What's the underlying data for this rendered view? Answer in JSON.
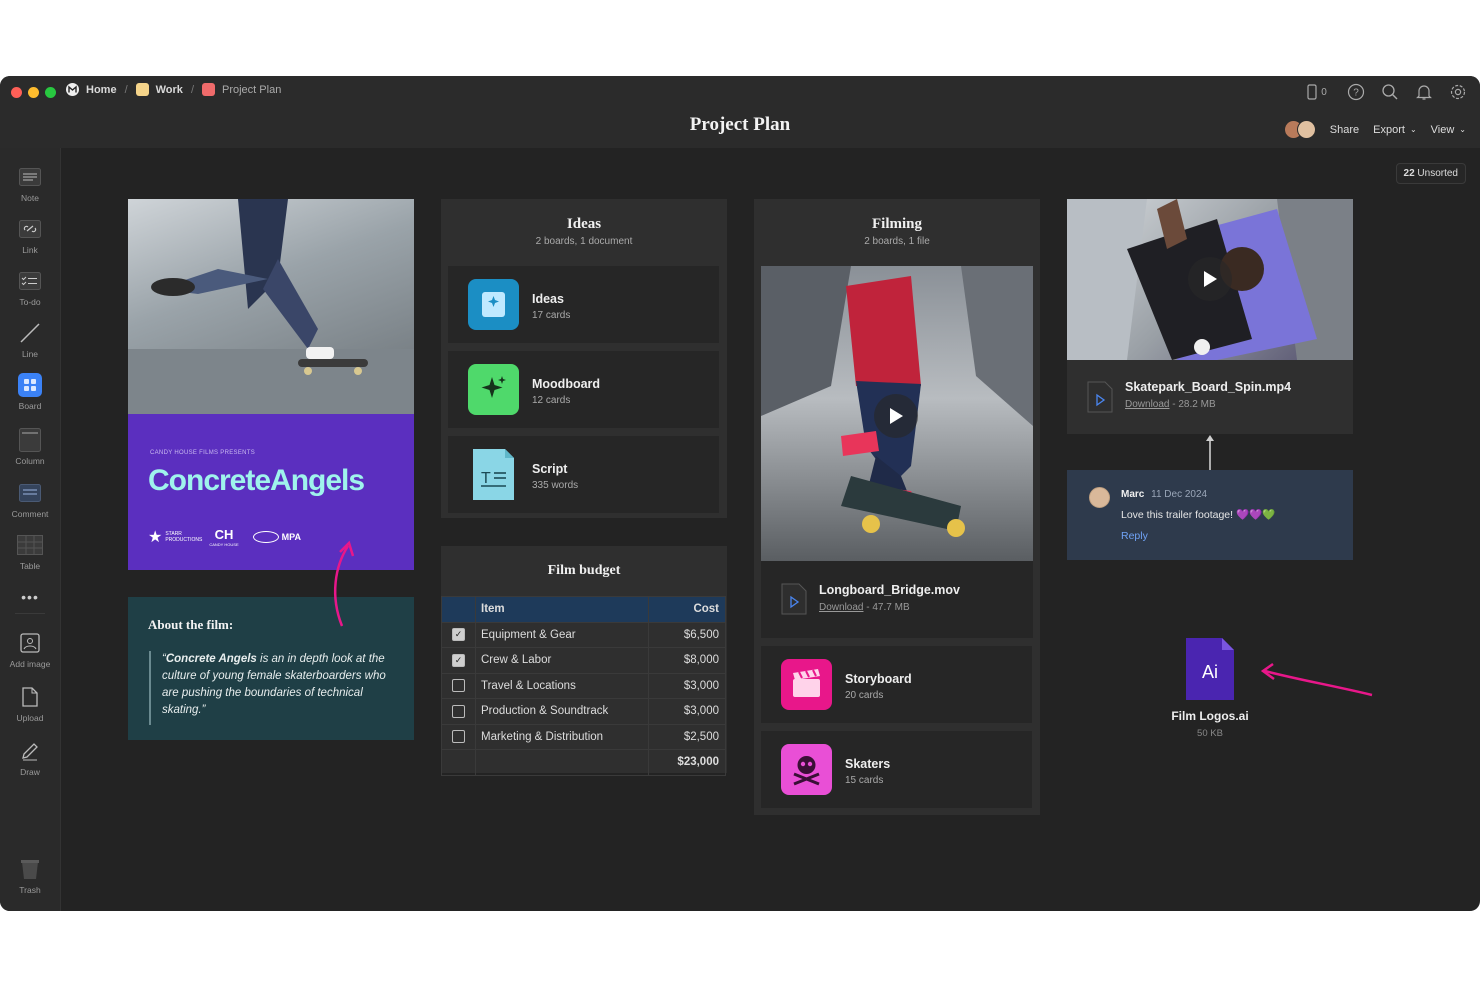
{
  "breadcrumb": {
    "home": "Home",
    "work": "Work",
    "current": "Project Plan"
  },
  "header": {
    "title": "Project Plan",
    "device_count": "0",
    "share": "Share",
    "export": "Export",
    "view": "View"
  },
  "unsorted": {
    "count": "22",
    "label": "Unsorted"
  },
  "sidebar": {
    "tools": [
      "Note",
      "Link",
      "To-do",
      "Line",
      "Board",
      "Column",
      "Comment",
      "Table",
      "Add image",
      "Upload",
      "Draw"
    ],
    "trash": "Trash"
  },
  "poster": {
    "presents": "CANDY HOUSE FILMS PRESENTS",
    "title": "ConcreteAngels",
    "logos": [
      "STARR PRODUCTIONS",
      "CANDY HOUSE",
      "MPA"
    ]
  },
  "about": {
    "heading": "About the film:",
    "quote_open": "“",
    "quote_bold": "Concrete Angels",
    "quote_rest": " is an in depth look at the culture of young female skaterboarders who are pushing the boundaries of technical skating.”"
  },
  "ideas_column": {
    "title": "Ideas",
    "subtitle": "2 boards, 1 document",
    "items": [
      {
        "name": "Ideas",
        "count": "17 cards"
      },
      {
        "name": "Moodboard",
        "count": "12 cards"
      },
      {
        "name": "Script",
        "count": "335 words"
      }
    ]
  },
  "budget": {
    "title": "Film budget",
    "headers": {
      "item": "Item",
      "cost": "Cost"
    },
    "rows": [
      {
        "item": "Equipment & Gear",
        "cost": "$6,500",
        "checked": true
      },
      {
        "item": "Crew & Labor",
        "cost": "$8,000",
        "checked": true
      },
      {
        "item": "Travel & Locations",
        "cost": "$3,000",
        "checked": false
      },
      {
        "item": "Production & Soundtrack",
        "cost": "$3,000",
        "checked": false
      },
      {
        "item": "Marketing & Distribution",
        "cost": "$2,500",
        "checked": false
      }
    ],
    "total": "$23,000"
  },
  "filming_column": {
    "title": "Filming",
    "subtitle": "2 boards, 1 file",
    "video": {
      "name": "Longboard_Bridge.mov",
      "download": "Download",
      "size": " - 47.7 MB"
    },
    "items": [
      {
        "name": "Storyboard",
        "count": "20 cards"
      },
      {
        "name": "Skaters",
        "count": "15 cards"
      }
    ]
  },
  "skatepark_video": {
    "name": "Skatepark_Board_Spin.mp4",
    "download": "Download",
    "size": " - 28.2 MB"
  },
  "comment": {
    "author": "Marc",
    "date": "11 Dec 2024",
    "text": "Love this trailer footage! 💜💜💚",
    "reply": "Reply"
  },
  "file": {
    "name": "Film Logos.ai",
    "size": "50 KB",
    "ext": "Ai"
  },
  "colors": {
    "accent_pink": "#e8178a",
    "poster_purple": "#5b2fbf",
    "about_teal": "#1f3f46",
    "comment_bg": "#2e3a4c"
  }
}
